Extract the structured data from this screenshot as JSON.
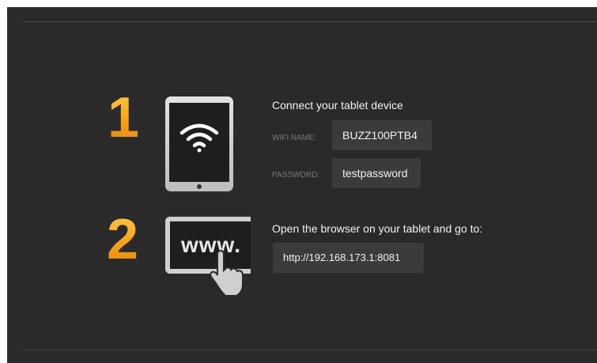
{
  "step1": {
    "number": "1",
    "title": "Connect your tablet device",
    "wifi_label": "WIFI NAME:",
    "wifi_value": "BUZZ100PTB4",
    "password_label": "PASSWORD:",
    "password_value": "testpassword"
  },
  "step2": {
    "number": "2",
    "title": "Open the browser on your tablet and go to:",
    "icon_text": "www.",
    "url": "http://192.168.173.1:8081"
  },
  "icons": {
    "tablet": "tablet-wifi-icon",
    "browser": "www-hand-icon"
  },
  "colors": {
    "background": "#2a2a2a",
    "number_accent": "#f7a21b",
    "box_background": "#3b3b3b"
  }
}
